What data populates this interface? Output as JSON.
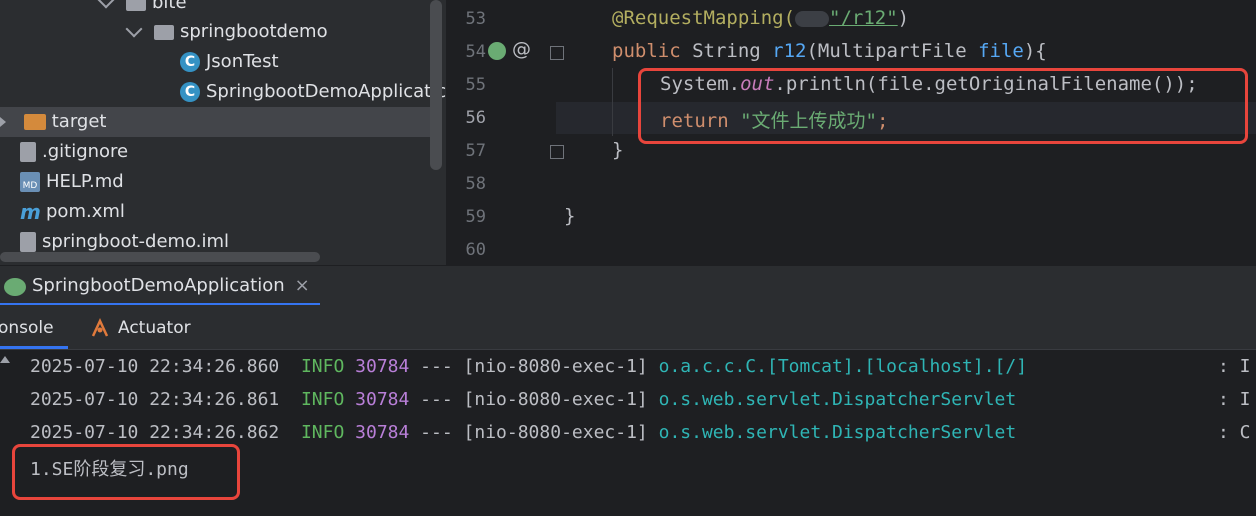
{
  "project_tree": {
    "items": [
      {
        "label": "bite",
        "kind": "package"
      },
      {
        "label": "springbootdemo",
        "kind": "package"
      },
      {
        "label": "JsonTest",
        "kind": "class"
      },
      {
        "label": "SpringbootDemoApplicatic",
        "kind": "class"
      },
      {
        "label": "target",
        "kind": "folder"
      },
      {
        "label": ".gitignore",
        "kind": "file"
      },
      {
        "label": "HELP.md",
        "kind": "markdown"
      },
      {
        "label": "pom.xml",
        "kind": "maven"
      },
      {
        "label": "springboot-demo.iml",
        "kind": "module-file"
      }
    ]
  },
  "editor": {
    "line_numbers": [
      "53",
      "54",
      "55",
      "56",
      "57",
      "58",
      "59",
      "60"
    ],
    "current_line": "56",
    "code": {
      "l53_annotation": "@RequestMapping(",
      "l53_path": "\"/r12\"",
      "l53_close": ")",
      "l54_kw": "public",
      "l54_type": " String ",
      "l54_name": "r12",
      "l54_params": "(MultipartFile ",
      "l54_param": "file",
      "l54_end": "){",
      "l55_sys": "System.",
      "l55_out": "out",
      "l55_call": ".println(file.getOriginalFilename());",
      "l56_kw": "return",
      "l56_str": " \"文件上传成功\"",
      "l56_semi": ";",
      "l57": "}",
      "l59": "}"
    }
  },
  "run_window": {
    "tab_label": "SpringbootDemoApplication",
    "close_glyph": "×",
    "subtabs": [
      "onsole",
      "Actuator"
    ]
  },
  "console": {
    "lines": [
      {
        "ts": "2025-07-10 22:34:26.860",
        "level": "INFO",
        "pid": "30784",
        "sep": "---",
        "thread": "[nio-8080-exec-1]",
        "logger": "o.a.c.c.C.[Tomcat].[localhost].[/]",
        "tail": ": I"
      },
      {
        "ts": "2025-07-10 22:34:26.861",
        "level": "INFO",
        "pid": "30784",
        "sep": "---",
        "thread": "[nio-8080-exec-1]",
        "logger": "o.s.web.servlet.DispatcherServlet",
        "tail": ": I"
      },
      {
        "ts": "2025-07-10 22:34:26.862",
        "level": "INFO",
        "pid": "30784",
        "sep": "---",
        "thread": "[nio-8080-exec-1]",
        "logger": "o.s.web.servlet.DispatcherServlet",
        "tail": ": C"
      }
    ],
    "output": "1.SE阶段复习.png"
  },
  "colors": {
    "highlight_box": "#e8453c",
    "accent": "#3574f0"
  }
}
